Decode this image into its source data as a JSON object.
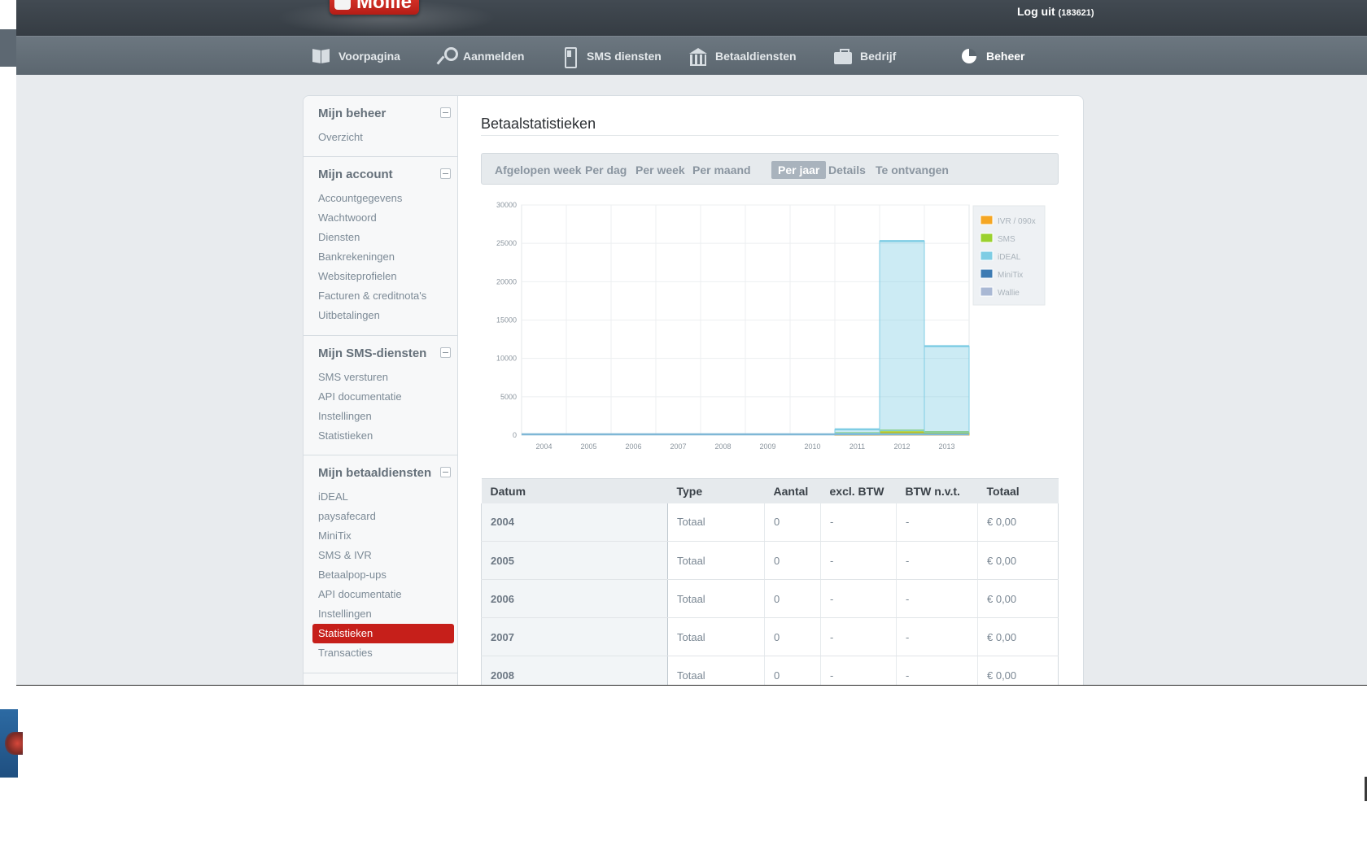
{
  "brand": {
    "logo_text": "Mollie"
  },
  "header": {
    "logout_label": "Log uit",
    "account_number": "(183621)"
  },
  "nav": {
    "items": [
      {
        "label": "Voorpagina",
        "icon": "book-icon"
      },
      {
        "label": "Aanmelden",
        "icon": "key-icon"
      },
      {
        "label": "SMS diensten",
        "icon": "phone-icon"
      },
      {
        "label": "Betaaldiensten",
        "icon": "bank-icon"
      },
      {
        "label": "Bedrijf",
        "icon": "briefcase-icon"
      },
      {
        "label": "Beheer",
        "icon": "pie-chart-icon",
        "active": true
      }
    ]
  },
  "sidebar": {
    "sections": [
      {
        "title": "Mijn beheer",
        "links": [
          "Overzicht"
        ]
      },
      {
        "title": "Mijn account",
        "links": [
          "Accountgegevens",
          "Wachtwoord",
          "Diensten",
          "Bankrekeningen",
          "Websiteprofielen",
          "Facturen & creditnota's",
          "Uitbetalingen"
        ]
      },
      {
        "title": "Mijn SMS-diensten",
        "links": [
          "SMS versturen",
          "API documentatie",
          "Instellingen",
          "Statistieken"
        ]
      },
      {
        "title": "Mijn betaaldiensten",
        "links": [
          "iDEAL",
          "paysafecard",
          "MiniTix",
          "SMS & IVR",
          "Betaalpop-ups",
          "API documentatie",
          "Instellingen",
          "Statistieken",
          "Transacties"
        ],
        "active_link": "Statistieken"
      }
    ]
  },
  "page": {
    "title": "Betaalstatistieken",
    "tabs": [
      "Afgelopen week",
      "Per dag",
      "Per week",
      "Per maand",
      "Per jaar",
      "Details",
      "Te ontvangen"
    ],
    "active_tab": "Per jaar"
  },
  "chart_data": {
    "type": "area",
    "stacked": true,
    "step": true,
    "x": [
      "2004",
      "2005",
      "2006",
      "2007",
      "2008",
      "2009",
      "2010",
      "2011",
      "2012",
      "2013"
    ],
    "ylim": [
      0,
      30000
    ],
    "yticks": [
      0,
      5000,
      10000,
      15000,
      20000,
      25000,
      30000
    ],
    "grid": true,
    "legend_position": "right",
    "series": [
      {
        "name": "IVR / 090x",
        "color": "#f5a623",
        "values": [
          0,
          0,
          0,
          0,
          0,
          0,
          0,
          100,
          300,
          200
        ]
      },
      {
        "name": "SMS",
        "color": "#9bd12f",
        "values": [
          0,
          0,
          0,
          0,
          0,
          0,
          0,
          150,
          300,
          200
        ]
      },
      {
        "name": "iDEAL",
        "color": "#7fcde4",
        "values": [
          0,
          0,
          0,
          0,
          0,
          0,
          0,
          500,
          24700,
          11200
        ]
      },
      {
        "name": "MiniTix",
        "color": "#3d7bb3",
        "values": [
          0,
          0,
          0,
          0,
          0,
          0,
          0,
          0,
          0,
          0
        ]
      },
      {
        "name": "Wallie",
        "color": "#a9b8d4",
        "values": [
          0,
          0,
          0,
          0,
          0,
          0,
          0,
          0,
          0,
          0
        ]
      }
    ]
  },
  "table": {
    "headers": [
      "Datum",
      "Type",
      "Aantal",
      "excl. BTW",
      "BTW n.v.t.",
      "Totaal"
    ],
    "rows": [
      [
        "2004",
        "Totaal",
        "0",
        "-",
        "-",
        "€ 0,00"
      ],
      [
        "2005",
        "Totaal",
        "0",
        "-",
        "-",
        "€ 0,00"
      ],
      [
        "2006",
        "Totaal",
        "0",
        "-",
        "-",
        "€ 0,00"
      ],
      [
        "2007",
        "Totaal",
        "0",
        "-",
        "-",
        "€ 0,00"
      ],
      [
        "2008",
        "Totaal",
        "0",
        "-",
        "-",
        "€ 0,00"
      ]
    ]
  }
}
